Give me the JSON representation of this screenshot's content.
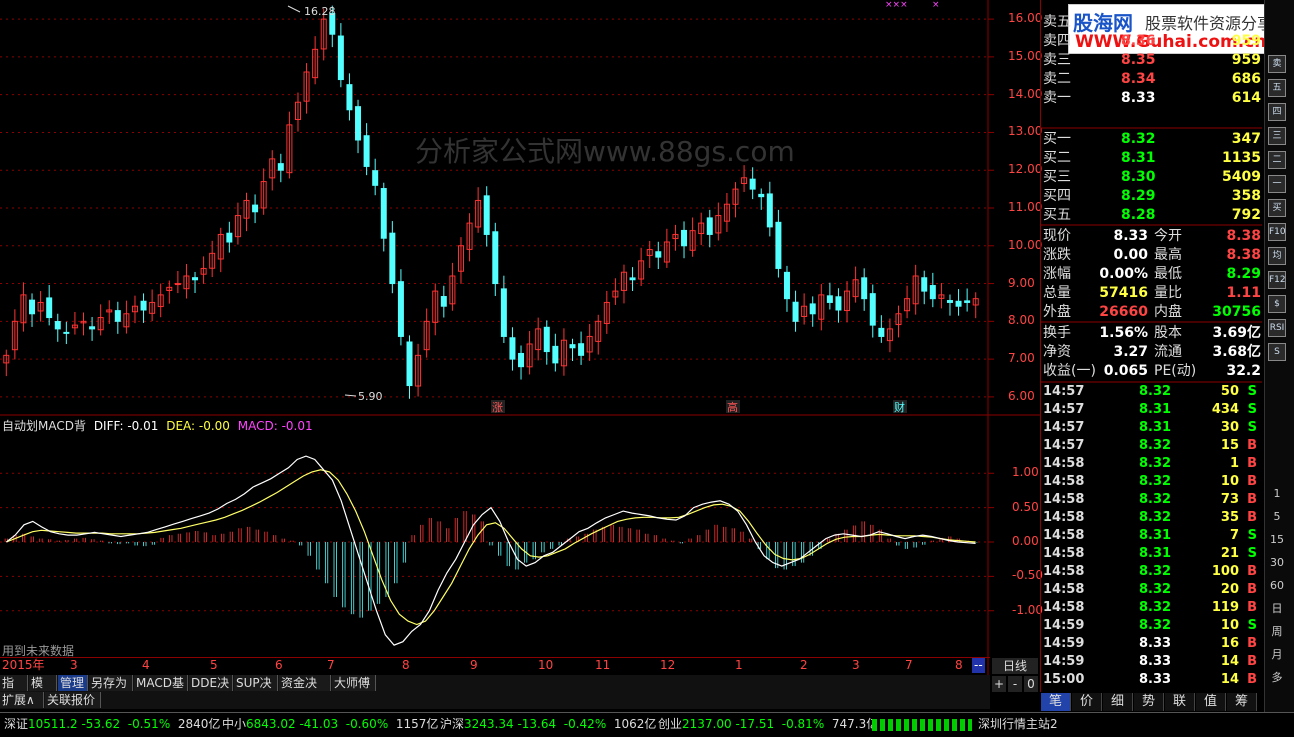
{
  "chart_data": {
    "type": "candlestick-macd",
    "price": {
      "ylim": [
        5.6,
        16.4
      ],
      "yticks": [
        "16.00",
        "15.00",
        "14.00",
        "13.00",
        "12.00",
        "11.00",
        "10.00",
        "9.00",
        "8.00",
        "7.00",
        "6.00"
      ],
      "max_label": "16.28",
      "min_label": "5.90",
      "closes": [
        7.1,
        8.0,
        8.7,
        8.2,
        8.5,
        8.1,
        7.8,
        7.7,
        7.9,
        8.0,
        7.8,
        8.1,
        8.3,
        8.0,
        8.2,
        8.4,
        8.3,
        8.5,
        8.7,
        8.9,
        9.0,
        9.2,
        9.1,
        9.4,
        9.8,
        10.3,
        10.1,
        10.8,
        11.2,
        10.9,
        11.7,
        12.3,
        12.0,
        13.2,
        13.8,
        14.6,
        15.2,
        16.0,
        15.6,
        14.4,
        13.6,
        12.8,
        12.1,
        11.6,
        10.2,
        9.0,
        7.6,
        6.3,
        7.1,
        8.0,
        8.8,
        8.4,
        9.2,
        10.0,
        10.6,
        11.2,
        10.3,
        9.0,
        7.6,
        7.0,
        6.8,
        7.4,
        7.8,
        7.2,
        6.9,
        7.5,
        7.3,
        7.1,
        7.6,
        8.0,
        8.5,
        8.8,
        9.3,
        9.1,
        9.6,
        9.9,
        9.7,
        10.1,
        10.3,
        10.0,
        10.4,
        10.6,
        10.3,
        10.8,
        11.1,
        11.5,
        11.8,
        11.5,
        11.3,
        10.5,
        9.4,
        8.6,
        8.0,
        8.4,
        8.2,
        8.7,
        8.5,
        8.3,
        8.8,
        9.1,
        8.6,
        7.9,
        7.6,
        7.8,
        8.2,
        8.6,
        9.2,
        8.8,
        8.6,
        8.7,
        8.5,
        8.4,
        8.5,
        8.6
      ],
      "markers": [
        "涨",
        "高",
        "财"
      ]
    },
    "macd": {
      "title": "自动划MACD背",
      "diff_label": "DIFF: -0.01",
      "dea_label": "DEA: -0.00",
      "macd_label": "MACD: -0.01",
      "ylim": [
        -1.6,
        1.6
      ],
      "yticks": [
        "1.00",
        "0.50",
        "0.00",
        "-0.50",
        "-1.00"
      ],
      "note": "用到未来数据",
      "hist": [
        0.05,
        0.1,
        0.12,
        0.08,
        0.05,
        0.04,
        0.02,
        0.03,
        0.05,
        0.06,
        0.04,
        0.02,
        -0.02,
        -0.03,
        -0.02,
        -0.05,
        -0.06,
        -0.04,
        0.06,
        0.1,
        0.12,
        0.14,
        0.16,
        0.14,
        0.1,
        0.12,
        0.15,
        0.2,
        0.22,
        0.18,
        0.15,
        0.1,
        0.05,
        0.02,
        -0.05,
        -0.2,
        -0.4,
        -0.6,
        -0.8,
        -0.95,
        -1.05,
        -1.1,
        -1.0,
        -0.9,
        -0.8,
        -0.6,
        -0.3,
        0.1,
        0.25,
        0.35,
        0.3,
        0.2,
        0.35,
        0.45,
        0.4,
        0.3,
        -0.05,
        -0.2,
        -0.35,
        -0.4,
        -0.3,
        -0.25,
        -0.15,
        -0.1,
        -0.05,
        0.05,
        0.08,
        0.12,
        0.18,
        0.22,
        0.25,
        0.22,
        0.2,
        0.18,
        0.12,
        0.1,
        0.05,
        0.02,
        -0.02,
        0.05,
        0.1,
        0.18,
        0.25,
        0.22,
        0.2,
        0.15,
        0.05,
        -0.1,
        -0.25,
        -0.38,
        -0.4,
        -0.35,
        -0.3,
        -0.2,
        -0.1,
        0.05,
        0.12,
        0.18,
        0.24,
        0.3,
        0.25,
        0.18,
        0.05,
        -0.05,
        -0.1,
        -0.08,
        -0.04,
        0.02,
        0.06,
        0.08,
        0.05,
        0.02,
        -0.01
      ],
      "diff": [
        0.0,
        0.1,
        0.25,
        0.3,
        0.22,
        0.15,
        0.12,
        0.1,
        0.1,
        0.12,
        0.14,
        0.12,
        0.1,
        0.08,
        0.1,
        0.12,
        0.14,
        0.18,
        0.22,
        0.26,
        0.3,
        0.34,
        0.38,
        0.42,
        0.48,
        0.56,
        0.62,
        0.7,
        0.8,
        0.86,
        0.92,
        1.0,
        1.08,
        1.2,
        1.25,
        1.2,
        1.05,
        0.9,
        0.6,
        0.2,
        -0.2,
        -0.6,
        -1.0,
        -1.35,
        -1.5,
        -1.45,
        -1.3,
        -1.2,
        -1.0,
        -0.7,
        -0.45,
        -0.25,
        0.0,
        0.25,
        0.4,
        0.5,
        0.3,
        0.0,
        -0.25,
        -0.35,
        -0.3,
        -0.2,
        -0.15,
        -0.05,
        0.05,
        0.15,
        0.2,
        0.28,
        0.35,
        0.4,
        0.45,
        0.42,
        0.4,
        0.38,
        0.35,
        0.33,
        0.32,
        0.38,
        0.5,
        0.55,
        0.58,
        0.6,
        0.55,
        0.45,
        0.25,
        0.0,
        -0.2,
        -0.3,
        -0.35,
        -0.3,
        -0.25,
        -0.15,
        -0.05,
        0.05,
        0.1,
        0.12,
        0.1,
        0.08,
        0.1,
        0.15,
        0.12,
        0.08,
        0.05,
        0.08,
        0.1,
        0.08,
        0.05,
        0.02,
        0.0,
        -0.01,
        -0.02
      ],
      "dea": [
        0.0,
        0.05,
        0.1,
        0.15,
        0.17,
        0.16,
        0.15,
        0.14,
        0.13,
        0.13,
        0.13,
        0.13,
        0.12,
        0.12,
        0.12,
        0.12,
        0.13,
        0.14,
        0.16,
        0.18,
        0.2,
        0.23,
        0.26,
        0.29,
        0.32,
        0.36,
        0.41,
        0.46,
        0.52,
        0.58,
        0.65,
        0.72,
        0.8,
        0.88,
        0.96,
        1.02,
        1.05,
        1.02,
        0.9,
        0.7,
        0.45,
        0.15,
        -0.2,
        -0.55,
        -0.85,
        -1.05,
        -1.15,
        -1.2,
        -1.15,
        -1.0,
        -0.8,
        -0.6,
        -0.35,
        -0.1,
        0.1,
        0.25,
        0.28,
        0.2,
        0.05,
        -0.1,
        -0.2,
        -0.22,
        -0.2,
        -0.15,
        -0.1,
        -0.02,
        0.05,
        0.12,
        0.18,
        0.24,
        0.3,
        0.33,
        0.35,
        0.36,
        0.36,
        0.35,
        0.35,
        0.36,
        0.4,
        0.45,
        0.5,
        0.54,
        0.55,
        0.52,
        0.45,
        0.3,
        0.12,
        -0.05,
        -0.18,
        -0.24,
        -0.26,
        -0.24,
        -0.18,
        -0.1,
        -0.02,
        0.04,
        0.07,
        0.08,
        0.08,
        0.1,
        0.11,
        0.1,
        0.09,
        0.09,
        0.09,
        0.08,
        0.07,
        0.05,
        0.03,
        0.02,
        0.01,
        0.0
      ]
    },
    "xaxis": {
      "labels": [
        "2015年",
        "3",
        "4",
        "5",
        "6",
        "7",
        "8",
        "9",
        "10",
        "11",
        "12",
        "1",
        "2",
        "3",
        "7",
        "8",
        "--"
      ]
    }
  },
  "orderbook": {
    "sell": [
      {
        "label": "卖五",
        "price": "",
        "vol": ""
      },
      {
        "label": "卖四",
        "price": "8.36",
        "vol": "959"
      },
      {
        "label": "卖三",
        "price": "8.35",
        "vol": "959"
      },
      {
        "label": "卖二",
        "price": "8.34",
        "vol": "686"
      },
      {
        "label": "卖一",
        "price": "8.33",
        "vol": "614"
      }
    ],
    "sell_top_label": "卖",
    "buy": [
      {
        "label": "买一",
        "price": "8.32",
        "vol": "347"
      },
      {
        "label": "买二",
        "price": "8.31",
        "vol": "1135"
      },
      {
        "label": "买三",
        "price": "8.30",
        "vol": "5409"
      },
      {
        "label": "买四",
        "price": "8.29",
        "vol": "358"
      },
      {
        "label": "买五",
        "price": "8.28",
        "vol": "792"
      }
    ]
  },
  "quote": {
    "rows": [
      {
        "l1": "现价",
        "v1": "8.33",
        "l2": "今开",
        "v2": "8.38"
      },
      {
        "l1": "涨跌",
        "v1": "0.00",
        "l2": "最高",
        "v2": "8.38"
      },
      {
        "l1": "涨幅",
        "v1": "0.00%",
        "l2": "最低",
        "v2": "8.29"
      },
      {
        "l1": "总量",
        "v1": "57416",
        "l2": "量比",
        "v2": "1.11"
      },
      {
        "l1": "外盘",
        "v1": "26660",
        "l2": "内盘",
        "v2": "30756"
      }
    ],
    "rows2": [
      {
        "l1": "换手",
        "v1": "1.56%",
        "l2": "股本",
        "v2": "3.69亿"
      },
      {
        "l1": "净资",
        "v1": "3.27",
        "l2": "流通",
        "v2": "3.68亿"
      },
      {
        "l1": "收益(一)",
        "v1": "0.065",
        "l2": "PE(动)",
        "v2": "32.2"
      }
    ]
  },
  "ticks": [
    {
      "t": "14:57",
      "p": "8.32",
      "v": "50",
      "s": "S"
    },
    {
      "t": "14:57",
      "p": "8.31",
      "v": "434",
      "s": "S"
    },
    {
      "t": "14:57",
      "p": "8.31",
      "v": "30",
      "s": "S"
    },
    {
      "t": "14:57",
      "p": "8.32",
      "v": "15",
      "s": "B"
    },
    {
      "t": "14:58",
      "p": "8.32",
      "v": "1",
      "s": "B"
    },
    {
      "t": "14:58",
      "p": "8.32",
      "v": "10",
      "s": "B"
    },
    {
      "t": "14:58",
      "p": "8.32",
      "v": "73",
      "s": "B"
    },
    {
      "t": "14:58",
      "p": "8.32",
      "v": "35",
      "s": "B"
    },
    {
      "t": "14:58",
      "p": "8.31",
      "v": "7",
      "s": "S"
    },
    {
      "t": "14:58",
      "p": "8.31",
      "v": "21",
      "s": "S"
    },
    {
      "t": "14:58",
      "p": "8.32",
      "v": "100",
      "s": "B"
    },
    {
      "t": "14:58",
      "p": "8.32",
      "v": "20",
      "s": "B"
    },
    {
      "t": "14:58",
      "p": "8.32",
      "v": "119",
      "s": "B"
    },
    {
      "t": "14:59",
      "p": "8.32",
      "v": "10",
      "s": "S"
    },
    {
      "t": "14:59",
      "p": "8.33",
      "v": "16",
      "s": "B"
    },
    {
      "t": "14:59",
      "p": "8.33",
      "v": "14",
      "s": "B"
    },
    {
      "t": "15:00",
      "p": "8.33",
      "v": "14",
      "s": "B"
    }
  ],
  "watermark": {
    "logo_main": "股海网",
    "logo_sub": "股票软件资源分享",
    "logo_url": "WWW.Guhai.com.cn",
    "center": "分析家公式网www.88gs.com"
  },
  "toolbar": [
    "指标",
    "模板",
    "管理",
    "另存为",
    "MACD基本",
    "DDE决策",
    "SUP决策",
    "资金决策",
    "大师傅"
  ],
  "toolbar2": [
    "扩展∧",
    "关联报价"
  ],
  "period_label": "日线",
  "zoom_btns": [
    "+",
    "-",
    "0"
  ],
  "bottom_tabs": [
    "笔",
    "价",
    "细",
    "势",
    "联",
    "值",
    "筹"
  ],
  "side_icons": [
    "卖",
    "五",
    "四",
    "三",
    "二",
    "一",
    "买",
    "F10",
    "均",
    "F12",
    "$",
    "RSI",
    "S"
  ],
  "side_nums": [
    "1",
    "5",
    "15",
    "30",
    "60",
    "日",
    "周",
    "月",
    "多"
  ],
  "status": {
    "items": [
      {
        "name": "深证",
        "val": "10511.2",
        "chg": "-53.62",
        "pct": "-0.51%",
        "amt": "2840亿"
      },
      {
        "name": "中小",
        "val": "6843.02",
        "chg": "-41.03",
        "pct": "-0.60%",
        "amt": "1157亿"
      },
      {
        "name": "沪深",
        "val": "3243.34",
        "chg": "-13.64",
        "pct": "-0.42%",
        "amt": "1062亿"
      },
      {
        "name": "创业",
        "val": "2137.00",
        "chg": "-17.51",
        "pct": "-0.81%",
        "amt": "747.3亿"
      }
    ],
    "station": "深圳行情主站2"
  },
  "colors": {
    "up": "#ff3333",
    "down": "#54ffff",
    "grid": "#8b0000",
    "diff": "#ffffff",
    "dea": "#ffff66",
    "green": "#00ff00",
    "yellow": "#ffff44"
  }
}
